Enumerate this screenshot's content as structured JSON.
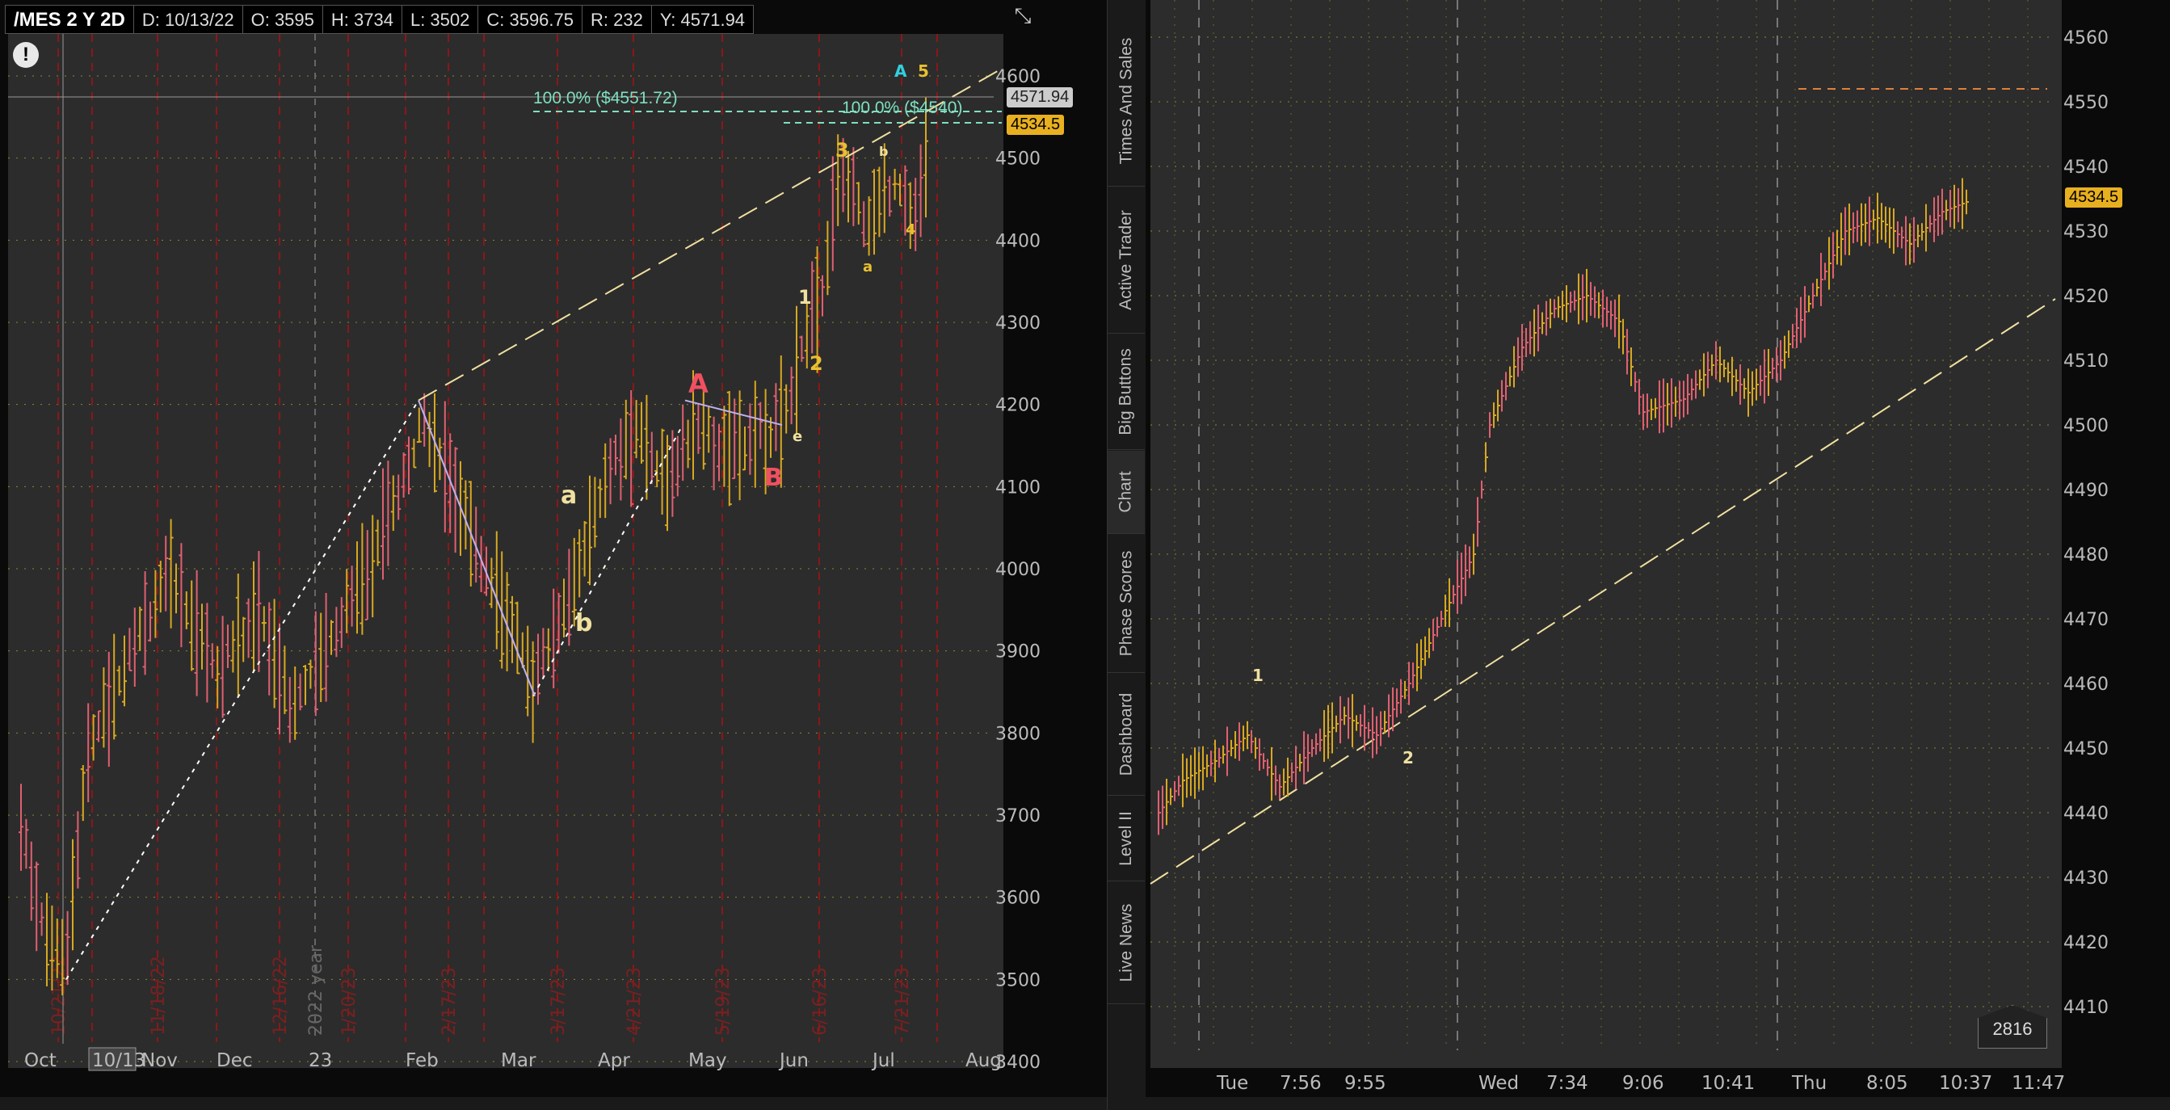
{
  "header": {
    "symbol": "/MES 2 Y 2D",
    "date": "D: 10/13/22",
    "open": "O: 3595",
    "high": "H: 3734",
    "low": "L: 3502",
    "close": "C: 3596.75",
    "range": "R: 232",
    "y": "Y: 4571.94"
  },
  "left_chart": {
    "price_labels": [
      "4600",
      "4500",
      "4400",
      "4300",
      "4200",
      "4100",
      "4000",
      "3900",
      "3800",
      "3700",
      "3600",
      "3500",
      "3400"
    ],
    "time_labels": [
      "Oct",
      "10/13",
      "Nov",
      "Dec",
      "23",
      "Feb",
      "Mar",
      "Apr",
      "May",
      "Jun",
      "Jul",
      "Aug"
    ],
    "cursor_price": "4571.94",
    "last_price": "4534.5",
    "fib_label_1": "100.0%  ($4551.72)",
    "fib_label_2": "100.0%  ($4540)",
    "year_label": "2022 year",
    "date_marks": [
      "10/21/22",
      "11/18/22",
      "12/16/22",
      "1/20/23",
      "2/17/23",
      "3/17/23",
      "4/21/23",
      "5/19/23",
      "6/16/23",
      "7/21/23"
    ],
    "wave_labels": {
      "A_top": "A",
      "five": "5",
      "three": "3",
      "b_small": "b",
      "four": "4",
      "a_small": "a",
      "one": "1",
      "two": "2",
      "A_red": "A",
      "e": "e",
      "B_red": "B",
      "a_big": "a",
      "b_big": "b"
    }
  },
  "right_chart": {
    "price_labels": [
      "4560",
      "4550",
      "4540",
      "4530",
      "4520",
      "4510",
      "4500",
      "4490",
      "4480",
      "4470",
      "4460",
      "4450",
      "4440",
      "4430",
      "4420",
      "4410"
    ],
    "time_labels": [
      "Tue",
      "7:56",
      "9:55",
      "Wed",
      "7:34",
      "9:06",
      "10:41",
      "Thu",
      "8:05",
      "10:37",
      "11:47"
    ],
    "last_price": "4534.5",
    "wave_labels": {
      "one": "1",
      "two": "2"
    },
    "count_box": "2816"
  },
  "side_tabs": [
    "Times And Sales",
    "Active Trader",
    "Big Buttons",
    "Chart",
    "Phase Scores",
    "Dashboard",
    "Level II",
    "Live News"
  ],
  "colors": {
    "up_bar": "#d8a820",
    "down_bar": "#e06070",
    "trendline": "#f0e0a0",
    "fib_line": "#7ee0c0",
    "red_grid": "#8a1818",
    "last_price_bg": "#e8b020",
    "wave_red": "#f05060",
    "wave_yellow": "#f0e0a0",
    "wave_cyan": "#30d0e0"
  }
}
